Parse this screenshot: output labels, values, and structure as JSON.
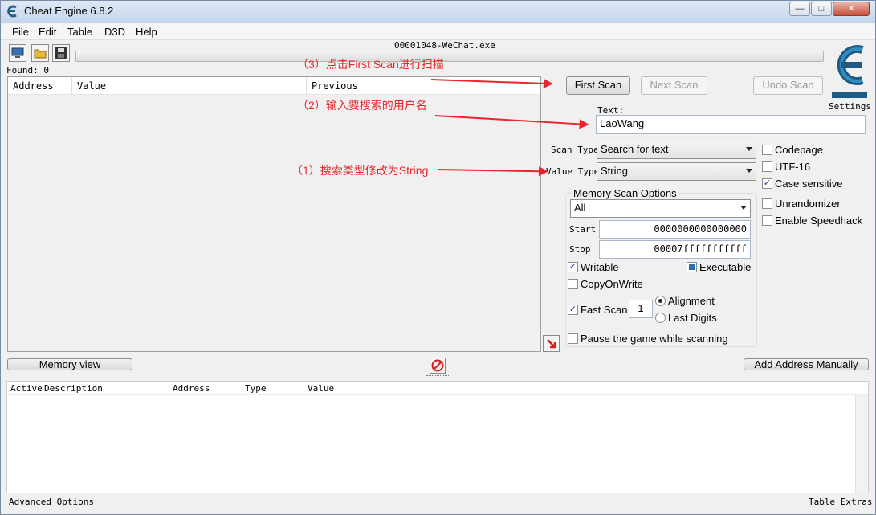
{
  "window": {
    "title": "Cheat Engine 6.8.2",
    "minimize": "—",
    "maximize": "□",
    "close": "✕"
  },
  "menu": [
    "File",
    "Edit",
    "Table",
    "D3D",
    "Help"
  ],
  "process_name": "00001048-WeChat.exe",
  "found_label": "Found: 0",
  "result_columns": [
    "Address",
    "Value",
    "Previous"
  ],
  "buttons": {
    "first_scan": "First Scan",
    "next_scan": "Next Scan",
    "undo_scan": "Undo Scan",
    "memory_view": "Memory view",
    "add_address": "Add Address Manually",
    "settings": "Settings"
  },
  "text_label": "Text:",
  "text_value": "LaoWang",
  "scan_type": {
    "label": "Scan Type",
    "value": "Search for text"
  },
  "value_type": {
    "label": "Value Type",
    "value": "String"
  },
  "right_options": {
    "codepage": {
      "label": "Codepage",
      "checked": false
    },
    "utf16": {
      "label": "UTF-16",
      "checked": false
    },
    "case_sensitive": {
      "label": "Case sensitive",
      "checked": true
    },
    "unrandomizer": {
      "label": "Unrandomizer",
      "checked": false
    },
    "speedhack": {
      "label": "Enable Speedhack",
      "checked": false
    }
  },
  "memory_options": {
    "title": "Memory Scan Options",
    "region": "All",
    "start_label": "Start",
    "start_value": "0000000000000000",
    "stop_label": "Stop",
    "stop_value": "00007fffffffffff",
    "writable": "Writable",
    "executable": "Executable",
    "copyonwrite": "CopyOnWrite",
    "fast_scan": "Fast Scan",
    "fast_scan_value": "1",
    "alignment": "Alignment",
    "last_digits": "Last Digits",
    "pause": "Pause the game while scanning"
  },
  "address_list_columns": [
    "Active",
    "Description",
    "Address",
    "Type",
    "Value"
  ],
  "footer": {
    "left": "Advanced Options",
    "right": "Table Extras"
  },
  "annotations": {
    "step3": "（3）点击First Scan进行扫描",
    "step2": "（2）输入要搜索的用户名",
    "step1": "（1）搜索类型修改为String"
  },
  "colors": {
    "annotation": "#e8262b",
    "accent": "#1a3f8a"
  }
}
